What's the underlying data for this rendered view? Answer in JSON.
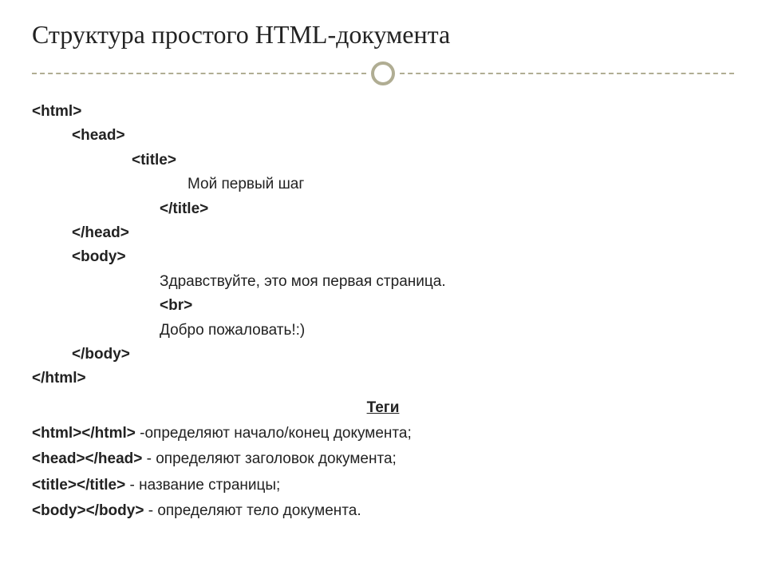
{
  "title": "Структура простого HTML-документа",
  "code": {
    "html_open": "<html>",
    "head_open": "<head>",
    "title_open": "<title>",
    "title_content": "Мой первый шаг",
    "title_close": "</title>",
    "head_close": "</head>",
    "body_open": "<body>",
    "body_line1": "Здравствуйте, это моя первая страница.",
    "body_br": "<br>",
    "body_line2": "Добро пожаловать!:)",
    "body_close": "</body>",
    "html_close": "</html>"
  },
  "tags_section": {
    "heading": "Теги",
    "html_tag": "<html></html>",
    "html_desc": " -определяют начало/конец документа;",
    "head_tag": "<head></head>",
    "head_desc": " - определяют заголовок документа;",
    "title_tag": "<title></title>",
    "title_desc": " - название страницы;",
    "body_tag": "<body></body>",
    "body_desc": " - определяют тело документа."
  }
}
